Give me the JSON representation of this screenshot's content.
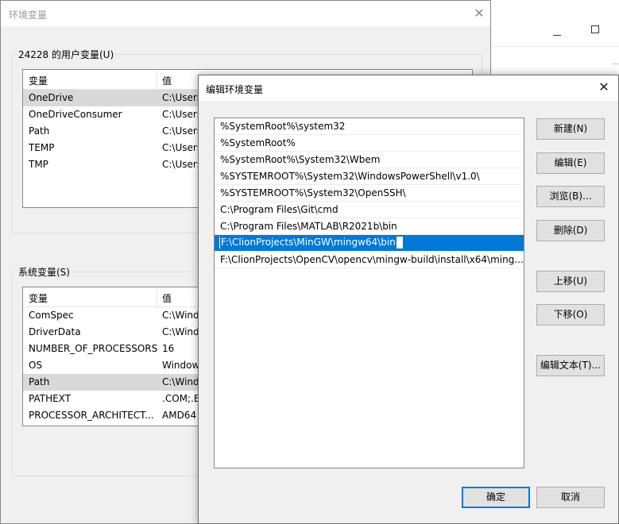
{
  "env_window": {
    "title": "环境变量",
    "user_group_label": "24228 的用户变量(U)",
    "system_group_label": "系统变量(S)",
    "col_name": "变量",
    "col_value": "值",
    "user_vars": [
      {
        "name": "OneDrive",
        "value": "C:\\Users"
      },
      {
        "name": "OneDriveConsumer",
        "value": "C:\\Users"
      },
      {
        "name": "Path",
        "value": "C:\\Users"
      },
      {
        "name": "TEMP",
        "value": "C:\\Users"
      },
      {
        "name": "TMP",
        "value": "C:\\Users"
      }
    ],
    "system_vars": [
      {
        "name": "ComSpec",
        "value": "C:\\Wind"
      },
      {
        "name": "DriverData",
        "value": "C:\\Wind"
      },
      {
        "name": "NUMBER_OF_PROCESSORS",
        "value": "16"
      },
      {
        "name": "OS",
        "value": "Window"
      },
      {
        "name": "Path",
        "value": "C:\\Wind"
      },
      {
        "name": "PATHEXT",
        "value": ".COM;.E"
      },
      {
        "name": "PROCESSOR_ARCHITECT...",
        "value": "AMD64"
      }
    ]
  },
  "edit_dialog": {
    "title": "编辑环境变量",
    "paths": [
      "%SystemRoot%\\system32",
      "%SystemRoot%",
      "%SystemRoot%\\System32\\Wbem",
      "%SYSTEMROOT%\\System32\\WindowsPowerShell\\v1.0\\",
      "%SYSTEMROOT%\\System32\\OpenSSH\\",
      "C:\\Program Files\\Git\\cmd",
      "C:\\Program Files\\MATLAB\\R2021b\\bin",
      "F:\\ClionProjects\\MinGW\\mingw64\\bin",
      "F:\\ClionProjects\\OpenCV\\opencv\\mingw-build\\install\\x64\\ming..."
    ],
    "selected_index": 7,
    "buttons": {
      "new": "新建(N)",
      "edit": "编辑(E)",
      "browse": "浏览(B)...",
      "delete": "删除(D)",
      "move_up": "上移(U)",
      "move_down": "下移(O)",
      "edit_text": "编辑文本(T)...",
      "ok": "确定",
      "cancel": "取消"
    }
  },
  "colors": {
    "accent": "#0078d7",
    "dialog_bg": "#f0f0f0",
    "button_bg": "#e1e1e1"
  }
}
